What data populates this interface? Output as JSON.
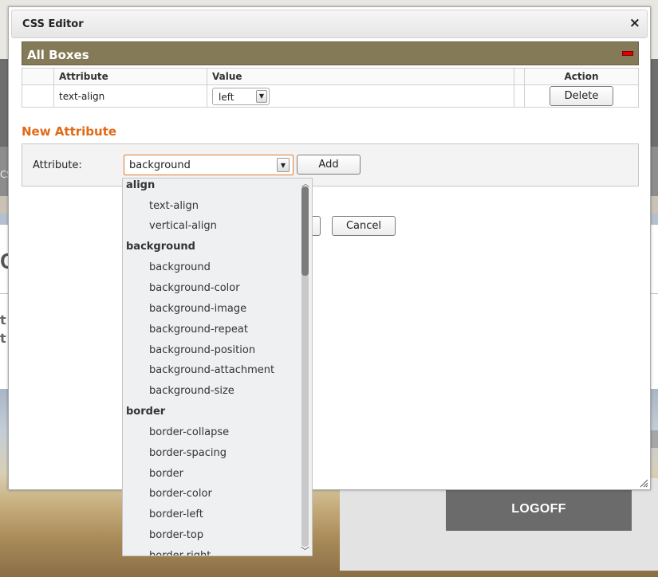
{
  "background": {
    "left_fragment_band": "CS",
    "left_fragment_title": "C",
    "left_fragment_line1": "t",
    "left_fragment_line2": "t",
    "logoff_label": "LOGOFF"
  },
  "dialog": {
    "title": "CSS Editor",
    "close_glyph": "×",
    "section_title": "All Boxes",
    "table": {
      "headers": [
        "",
        "Attribute",
        "Value",
        "",
        "Action"
      ],
      "rows": [
        {
          "attribute": "text-align",
          "value": "left",
          "action_label": "Delete"
        }
      ]
    },
    "new_attribute_heading": "New Attribute",
    "attribute_label": "Attribute:",
    "attribute_value": "background",
    "add_label": "Add",
    "ok_label": "",
    "cancel_label": "Cancel"
  },
  "dropdown": {
    "groups": [
      {
        "name": "align",
        "options": [
          "text-align",
          "vertical-align"
        ]
      },
      {
        "name": "background",
        "options": [
          "background",
          "background-color",
          "background-image",
          "background-repeat",
          "background-position",
          "background-attachment",
          "background-size"
        ]
      },
      {
        "name": "border",
        "options": [
          "border-collapse",
          "border-spacing",
          "border",
          "border-color",
          "border-left",
          "border-top",
          "border-right"
        ]
      }
    ],
    "scroll_position": 0.0
  },
  "colors": {
    "section_header": "#857a58",
    "accent_heading": "#e06a17",
    "collapse_icon": "#e00000",
    "logoff_bg": "#6b6b6b"
  }
}
